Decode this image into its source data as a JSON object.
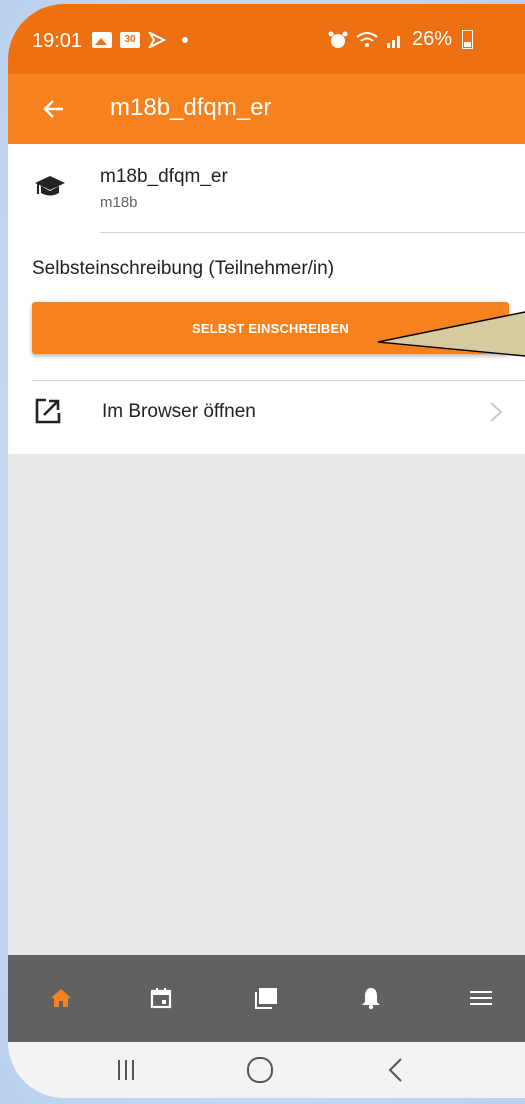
{
  "status_bar": {
    "time": "19:01",
    "calendar_day": "30",
    "battery": "26%"
  },
  "app_bar": {
    "title": "m18b_dfqm_er"
  },
  "course": {
    "title": "m18b_dfqm_er",
    "shortname": "m18b"
  },
  "enrolment": {
    "label": "Selbsteinschreibung (Teilnehmer/in)",
    "button_label": "SELBST EINSCHREIBEN"
  },
  "browser_link": {
    "label": "Im Browser öffnen"
  },
  "bottom_nav": {
    "items": [
      "home-icon",
      "calendar-icon",
      "messages-icon",
      "notifications-icon",
      "menu-icon"
    ],
    "active": "home-icon"
  },
  "colors": {
    "status_bar": "#ed7112",
    "accent": "#f5821f",
    "bottom_nav": "#616161",
    "callout_fill": "#d6caa0"
  }
}
